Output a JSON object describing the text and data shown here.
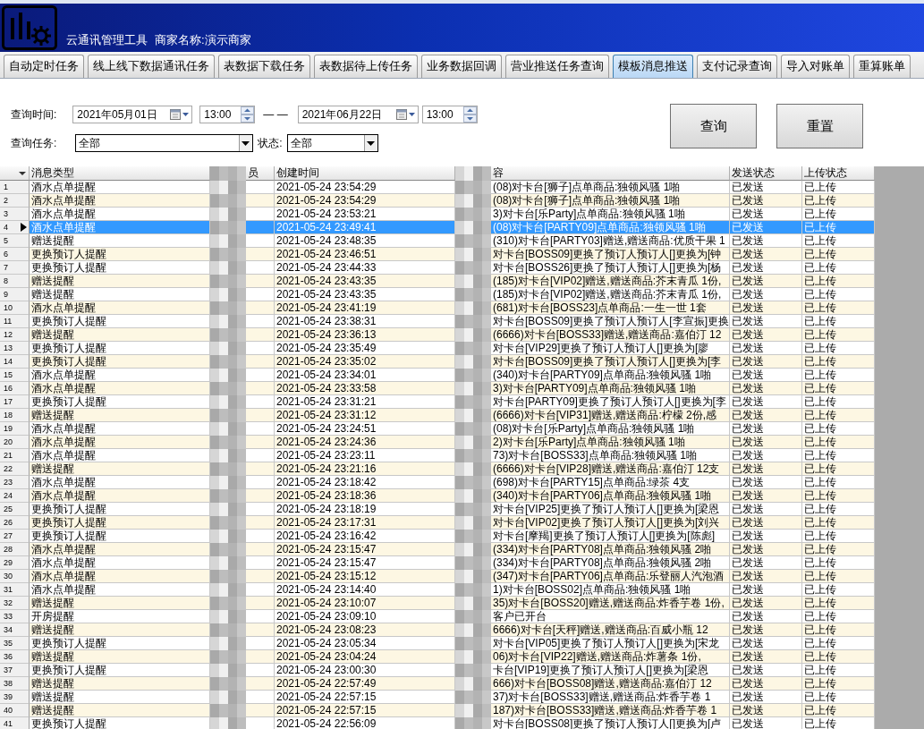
{
  "app": {
    "title": "云通讯管理工具",
    "merchant": "商家名称:演示商家"
  },
  "tabs": [
    {
      "label": "自动定时任务",
      "selected": false
    },
    {
      "label": "线上线下数据通讯任务",
      "selected": false
    },
    {
      "label": "表数据下载任务",
      "selected": false
    },
    {
      "label": "表数据待上传任务",
      "selected": false
    },
    {
      "label": "业务数据回调",
      "selected": false
    },
    {
      "label": "营业推送任务查询",
      "selected": false
    },
    {
      "label": "模板消息推送",
      "selected": true
    },
    {
      "label": "支付记录查询",
      "selected": false
    },
    {
      "label": "导入对账单",
      "selected": false
    },
    {
      "label": "重算账单",
      "selected": false
    }
  ],
  "filters": {
    "time_label": "查询时间:",
    "start_date": "2021年05月01日",
    "start_time": "13:00",
    "range_separator": "— —",
    "end_date": "2021年06月22日",
    "end_time": "13:00",
    "task_label": "查询任务:",
    "task_value": "全部",
    "status_label": "状态:",
    "status_value": "全部"
  },
  "buttons": [
    "查询",
    "重置"
  ],
  "table": {
    "columns": [
      "消息类型",
      "员",
      "创建时间",
      "容",
      "发送状态",
      "上传状态"
    ],
    "rows": [
      {
        "no": "1",
        "type": "酒水点单提醒",
        "time": "2021-05-24 23:54:29",
        "content": "(08)对卡台[狮子]点单商品:独领风骚 1啪",
        "send": "已发送",
        "upload": "已上传",
        "selected": false
      },
      {
        "no": "2",
        "type": "酒水点单提醒",
        "time": "2021-05-24 23:54:29",
        "content": "(08)对卡台[狮子]点单商品:独领风骚 1啪",
        "send": "已发送",
        "upload": "已上传",
        "selected": false
      },
      {
        "no": "3",
        "type": "酒水点单提醒",
        "time": "2021-05-24 23:53:21",
        "content": "3)对卡台[乐Party]点单商品:独领风骚 1啪",
        "send": "已发送",
        "upload": "已上传",
        "selected": false
      },
      {
        "no": "4",
        "type": "酒水点单提醒",
        "time": "2021-05-24 23:49:41",
        "content": "(08)对卡台[PARTY09]点单商品:独领风骚 1啪",
        "send": "已发送",
        "upload": "已上传",
        "selected": true
      },
      {
        "no": "5",
        "type": "赠送提醒",
        "time": "2021-05-24 23:48:35",
        "content": "(310)对卡台[PARTY03]赠送,赠送商品:优质干果 1",
        "send": "已发送",
        "upload": "已上传",
        "selected": false
      },
      {
        "no": "6",
        "type": "更换预订人提醒",
        "time": "2021-05-24 23:46:51",
        "content": "对卡台[BOSS09]更换了预订人预订人[]更换为[钟",
        "send": "已发送",
        "upload": "已上传",
        "selected": false
      },
      {
        "no": "7",
        "type": "更换预订人提醒",
        "time": "2021-05-24 23:44:33",
        "content": "对卡台[BOSS26]更换了预订人预订人[]更换为[杨",
        "send": "已发送",
        "upload": "已上传",
        "selected": false
      },
      {
        "no": "8",
        "type": "赠送提醒",
        "time": "2021-05-24 23:43:35",
        "content": "(185)对卡台[VIP02]赠送,赠送商品:芥末青瓜 1份,",
        "send": "已发送",
        "upload": "已上传",
        "selected": false
      },
      {
        "no": "9",
        "type": "赠送提醒",
        "time": "2021-05-24 23:43:35",
        "content": "(185)对卡台[VIP02]赠送,赠送商品:芥末青瓜 1份,",
        "send": "已发送",
        "upload": "已上传",
        "selected": false
      },
      {
        "no": "10",
        "type": "酒水点单提醒",
        "time": "2021-05-24 23:41:19",
        "content": "(681)对卡台[BOSS23]点单商品:一生一世 1套",
        "send": "已发送",
        "upload": "已上传",
        "selected": false
      },
      {
        "no": "11",
        "type": "更换预订人提醒",
        "time": "2021-05-24 23:38:31",
        "content": "对卡台[BOSS09]更换了预订人预订人[李宣振]更换",
        "send": "已发送",
        "upload": "已上传",
        "selected": false
      },
      {
        "no": "12",
        "type": "赠送提醒",
        "time": "2021-05-24 23:36:13",
        "content": "(6666)对卡台[BOSS33]赠送,赠送商品:嘉伯汀 12",
        "send": "已发送",
        "upload": "已上传",
        "selected": false
      },
      {
        "no": "13",
        "type": "更换预订人提醒",
        "time": "2021-05-24 23:35:49",
        "content": "对卡台[VIP29]更换了预订人预订人[]更换为[廖",
        "send": "已发送",
        "upload": "已上传",
        "selected": false
      },
      {
        "no": "14",
        "type": "更换预订人提醒",
        "time": "2021-05-24 23:35:02",
        "content": "对卡台[BOSS09]更换了预订人预订人[]更换为[李",
        "send": "已发送",
        "upload": "已上传",
        "selected": false
      },
      {
        "no": "15",
        "type": "酒水点单提醒",
        "time": "2021-05-24 23:34:01",
        "content": "(340)对卡台[PARTY09]点单商品:独领风骚 1啪",
        "send": "已发送",
        "upload": "已上传",
        "selected": false
      },
      {
        "no": "16",
        "type": "酒水点单提醒",
        "time": "2021-05-24 23:33:58",
        "content": "3)对卡台[PARTY09]点单商品:独领风骚 1啪",
        "send": "已发送",
        "upload": "已上传",
        "selected": false
      },
      {
        "no": "17",
        "type": "更换预订人提醒",
        "time": "2021-05-24 23:31:21",
        "content": "对卡台[PARTY09]更换了预订人预订人[]更换为[李",
        "send": "已发送",
        "upload": "已上传",
        "selected": false
      },
      {
        "no": "18",
        "type": "赠送提醒",
        "time": "2021-05-24 23:31:12",
        "content": "(6666)对卡台[VIP31]赠送,赠送商品:柠檬 2份,感",
        "send": "已发送",
        "upload": "已上传",
        "selected": false
      },
      {
        "no": "19",
        "type": "酒水点单提醒",
        "time": "2021-05-24 23:24:51",
        "content": "(08)对卡台[乐Party]点单商品:独领风骚 1啪",
        "send": "已发送",
        "upload": "已上传",
        "selected": false
      },
      {
        "no": "20",
        "type": "酒水点单提醒",
        "time": "2021-05-24 23:24:36",
        "content": "2)对卡台[乐Party]点单商品:独领风骚 1啪",
        "send": "已发送",
        "upload": "已上传",
        "selected": false
      },
      {
        "no": "21",
        "type": "酒水点单提醒",
        "time": "2021-05-24 23:23:11",
        "content": "73)对卡台[BOSS33]点单商品:独领风骚 1啪",
        "send": "已发送",
        "upload": "已上传",
        "selected": false
      },
      {
        "no": "22",
        "type": "赠送提醒",
        "time": "2021-05-24 23:21:16",
        "content": "(6666)对卡台[VIP28]赠送,赠送商品:嘉伯汀 12支",
        "send": "已发送",
        "upload": "已上传",
        "selected": false
      },
      {
        "no": "23",
        "type": "酒水点单提醒",
        "time": "2021-05-24 23:18:42",
        "content": "(698)对卡台[PARTY15]点单商品:绿茶 4支",
        "send": "已发送",
        "upload": "已上传",
        "selected": false
      },
      {
        "no": "24",
        "type": "酒水点单提醒",
        "time": "2021-05-24 23:18:36",
        "content": "(340)对卡台[PARTY06]点单商品:独领风骚 1啪",
        "send": "已发送",
        "upload": "已上传",
        "selected": false
      },
      {
        "no": "25",
        "type": "更换预订人提醒",
        "time": "2021-05-24 23:18:19",
        "content": "对卡台[VIP25]更换了预订人预订人[]更换为[梁恩",
        "send": "已发送",
        "upload": "已上传",
        "selected": false
      },
      {
        "no": "26",
        "type": "更换预订人提醒",
        "time": "2021-05-24 23:17:31",
        "content": "对卡台[VIP02]更换了预订人预订人[]更换为[刘兴",
        "send": "已发送",
        "upload": "已上传",
        "selected": false
      },
      {
        "no": "27",
        "type": "更换预订人提醒",
        "time": "2021-05-24 23:16:42",
        "content": "对卡台[摩羯]更换了预订人预订人[]更换为[陈彪]",
        "send": "已发送",
        "upload": "已上传",
        "selected": false
      },
      {
        "no": "28",
        "type": "酒水点单提醒",
        "time": "2021-05-24 23:15:47",
        "content": "(334)对卡台[PARTY08]点单商品:独领风骚 2啪",
        "send": "已发送",
        "upload": "已上传",
        "selected": false
      },
      {
        "no": "29",
        "type": "酒水点单提醒",
        "time": "2021-05-24 23:15:47",
        "content": "(334)对卡台[PARTY08]点单商品:独领风骚 2啪",
        "send": "已发送",
        "upload": "已上传",
        "selected": false
      },
      {
        "no": "30",
        "type": "酒水点单提醒",
        "time": "2021-05-24 23:15:12",
        "content": "(347)对卡台[PARTY06]点单商品:乐登丽人汽泡酒",
        "send": "已发送",
        "upload": "已上传",
        "selected": false
      },
      {
        "no": "31",
        "type": "酒水点单提醒",
        "time": "2021-05-24 23:14:40",
        "content": "1)对卡台[BOSS02]点单商品:独领风骚 1啪",
        "send": "已发送",
        "upload": "已上传",
        "selected": false
      },
      {
        "no": "32",
        "type": "赠送提醒",
        "time": "2021-05-24 23:10:07",
        "content": "35)对卡台[BOSS20]赠送,赠送商品:炸香芋卷 1份,",
        "send": "已发送",
        "upload": "已上传",
        "selected": false
      },
      {
        "no": "33",
        "type": "开房提醒",
        "time": "2021-05-24 23:09:10",
        "content": "客户已开台",
        "send": "已发送",
        "upload": "已上传",
        "selected": false
      },
      {
        "no": "34",
        "type": "赠送提醒",
        "time": "2021-05-24 23:08:23",
        "content": "6666)对卡台[天秤]赠送,赠送商品:百威小瓶 12",
        "send": "已发送",
        "upload": "已上传",
        "selected": false
      },
      {
        "no": "35",
        "type": "更换预订人提醒",
        "time": "2021-05-24 23:05:34",
        "content": "对卡台[VIP05]更换了预订人预订人[]更换为[宋龙",
        "send": "已发送",
        "upload": "已上传",
        "selected": false
      },
      {
        "no": "36",
        "type": "赠送提醒",
        "time": "2021-05-24 23:04:24",
        "content": "06)对卡台[VIP22]赠送,赠送商品:炸薯条 1份,",
        "send": "已发送",
        "upload": "已上传",
        "selected": false
      },
      {
        "no": "37",
        "type": "更换预订人提醒",
        "time": "2021-05-24 23:00:30",
        "content": "卡台[VIP19]更换了预订人预订人[]更换为[梁恩",
        "send": "已发送",
        "upload": "已上传",
        "selected": false
      },
      {
        "no": "38",
        "type": "赠送提醒",
        "time": "2021-05-24 22:57:49",
        "content": "666)对卡台[BOSS08]赠送,赠送商品:嘉伯汀 12",
        "send": "已发送",
        "upload": "已上传",
        "selected": false
      },
      {
        "no": "39",
        "type": "赠送提醒",
        "time": "2021-05-24 22:57:15",
        "content": "37)对卡台[BOSS33]赠送,赠送商品:炸香芋卷 1",
        "send": "已发送",
        "upload": "已上传",
        "selected": false
      },
      {
        "no": "40",
        "type": "赠送提醒",
        "time": "2021-05-24 22:57:15",
        "content": "187)对卡台[BOSS33]赠送,赠送商品:炸香芋卷 1",
        "send": "已发送",
        "upload": "已上传",
        "selected": false
      },
      {
        "no": "41",
        "type": "更换预订人提醒",
        "time": "2021-05-24 22:56:09",
        "content": "对卡台[BOSS08]更换了预订人预订人[]更换为[卢",
        "send": "已发送",
        "upload": "已上传",
        "selected": false
      }
    ]
  }
}
